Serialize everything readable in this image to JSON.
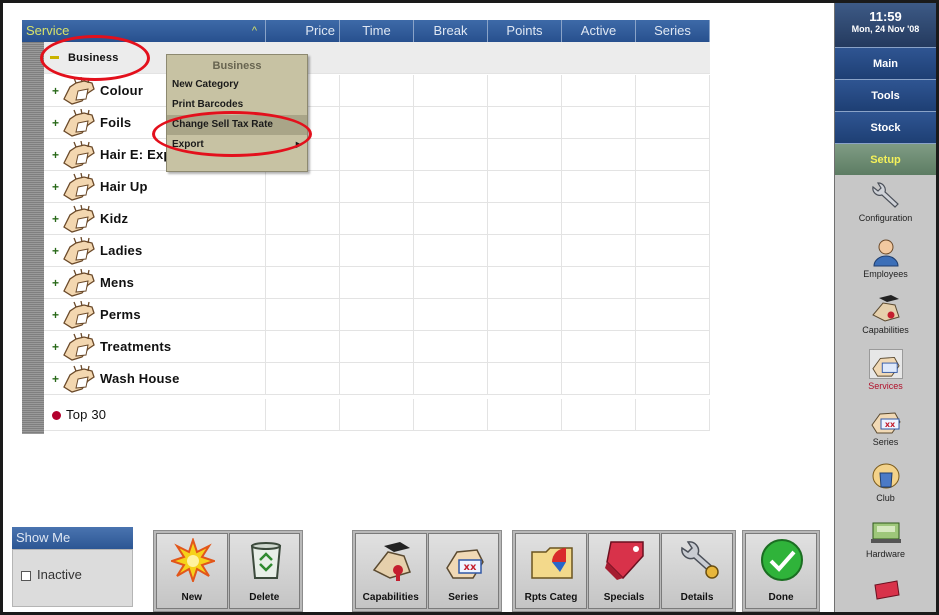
{
  "grid": {
    "headers": [
      "Service",
      "Price",
      "Time",
      "Break",
      "Points",
      "Active",
      "Series"
    ],
    "root_label": "Business",
    "categories": [
      "Colour",
      "Foils",
      "Hair E: Expert",
      "Hair Up",
      "Kidz",
      "Ladies",
      "Mens",
      "Perms",
      "Treatments",
      "Wash House"
    ],
    "bottom_item": "Top 30"
  },
  "context_menu": {
    "title": "Business",
    "items": [
      "New Category",
      "Print Barcodes",
      "Change Sell Tax Rate",
      "Export"
    ]
  },
  "show_me": {
    "title": "Show Me",
    "inactive_label": "Inactive",
    "inactive_checked": false
  },
  "toolbar": {
    "new": "New",
    "delete": "Delete",
    "capabilities": "Capabilities",
    "series": "Series",
    "rpts_categ": "Rpts Categ",
    "specials": "Specials",
    "details": "Details",
    "done": "Done"
  },
  "sidebar": {
    "time": "11:59",
    "date": "Mon, 24 Nov '08",
    "nav": [
      "Main",
      "Tools",
      "Stock",
      "Setup"
    ],
    "tools": [
      "Configuration",
      "Employees",
      "Capabilities",
      "Services",
      "Series",
      "Club",
      "Hardware"
    ]
  },
  "colors": {
    "header_blue": "#2f5592",
    "setup_green": "#6b8a70",
    "menu_beige": "#c7c2a3",
    "annotation_red": "#e3101c",
    "selected_label": "#b0102a"
  }
}
